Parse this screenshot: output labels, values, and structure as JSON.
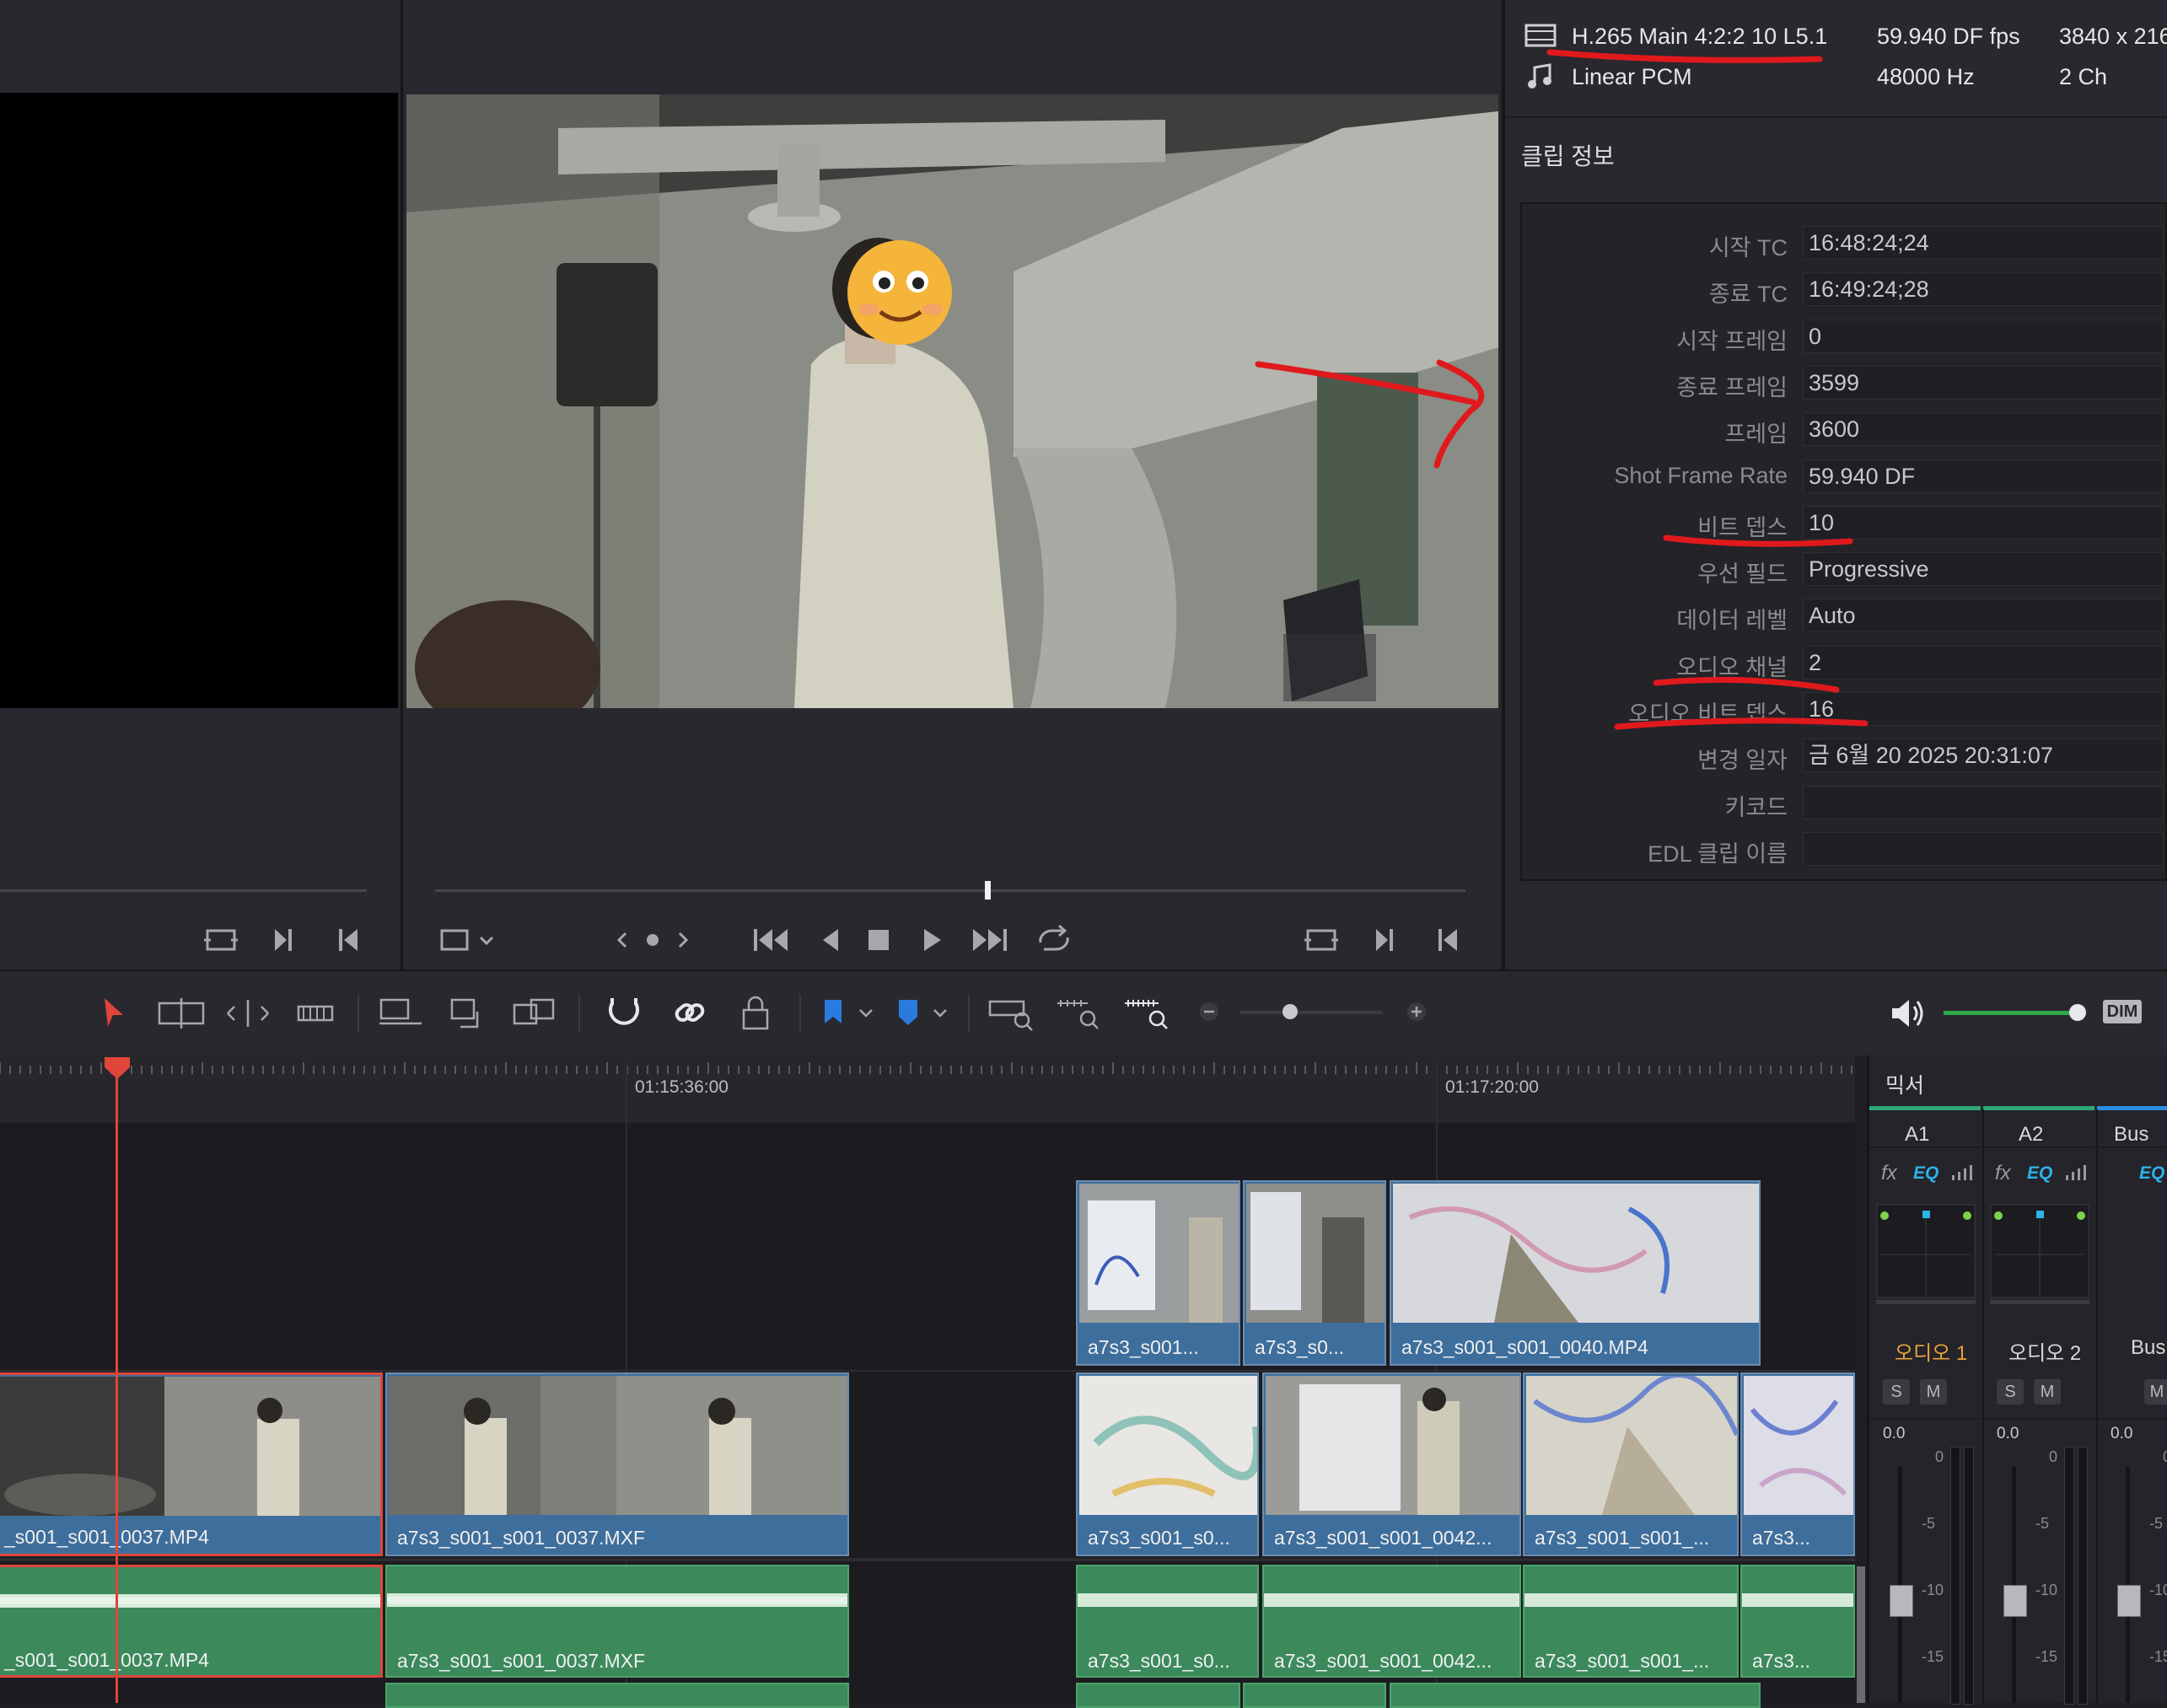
{
  "codec_info": {
    "video_codec": "H.265 Main 4:2:2 10 L5.1",
    "video_fps": "59.940 DF fps",
    "video_res": "3840 x 216",
    "audio_codec": "Linear PCM",
    "audio_rate": "48000 Hz",
    "audio_ch": "2 Ch"
  },
  "inspector": {
    "section_title": "클립 정보",
    "fields": [
      {
        "label": "시작 TC",
        "value": "16:48:24;24"
      },
      {
        "label": "종료 TC",
        "value": "16:49:24;28"
      },
      {
        "label": "시작 프레임",
        "value": "0"
      },
      {
        "label": "종료 프레임",
        "value": "3599"
      },
      {
        "label": "프레임",
        "value": "3600"
      },
      {
        "label": "Shot Frame Rate",
        "value": "59.940 DF"
      },
      {
        "label": "비트 뎁스",
        "value": "10"
      },
      {
        "label": "우선 필드",
        "value": "Progressive"
      },
      {
        "label": "데이터 레벨",
        "value": "Auto"
      },
      {
        "label": "오디오 채널",
        "value": "2"
      },
      {
        "label": "오디오 비트 뎁스",
        "value": "16"
      },
      {
        "label": "변경 일자",
        "value": "금 6월 20 2025 20:31:07"
      },
      {
        "label": "키코드",
        "value": ""
      },
      {
        "label": "EDL 클립 이름",
        "value": ""
      }
    ]
  },
  "timeline": {
    "ruler_marks": [
      "01:15:36:00",
      "01:17:20:00"
    ],
    "video_track_2_clips": [
      "a7s3_s001...",
      "a7s3_s0...",
      "a7s3_s001_s001_0040.MP4"
    ],
    "video_track_1_clips": [
      "_s001_s001_0037.MP4",
      "a7s3_s001_s001_0037.MXF",
      "a7s3_s001_s0...",
      "a7s3_s001_s001_0042...",
      "a7s3_s001_s001_...",
      "a7s3..."
    ],
    "audio_track_1_clips": [
      "_s001_s001_0037.MP4",
      "a7s3_s001_s001_0037.MXF",
      "a7s3_s001_s0...",
      "a7s3_s001_s001_0042...",
      "a7s3_s001_s001_...",
      "a7s3..."
    ]
  },
  "toolbar": {
    "dim_label": "DIM"
  },
  "mixer": {
    "title": "믹서",
    "channels": [
      {
        "id": "A1",
        "name": "오디오 1",
        "level": "0.0"
      },
      {
        "id": "A2",
        "name": "오디오 2",
        "level": "0.0"
      },
      {
        "id": "Bus",
        "name": "Bus",
        "level": "0.0"
      }
    ],
    "fx_label": "fx",
    "eq_label": "EQ",
    "solo_label": "S",
    "mute_label": "M",
    "scale": [
      "0",
      "-5",
      "-10",
      "-15"
    ]
  },
  "colors": {
    "annotation_red": "#e0191d",
    "playhead": "#e0453a",
    "video_clip": "#3e6e9c",
    "audio_clip": "#3c8a5c",
    "mixer_active": "#e8a33a",
    "accent_blue": "#2a8ee0"
  }
}
